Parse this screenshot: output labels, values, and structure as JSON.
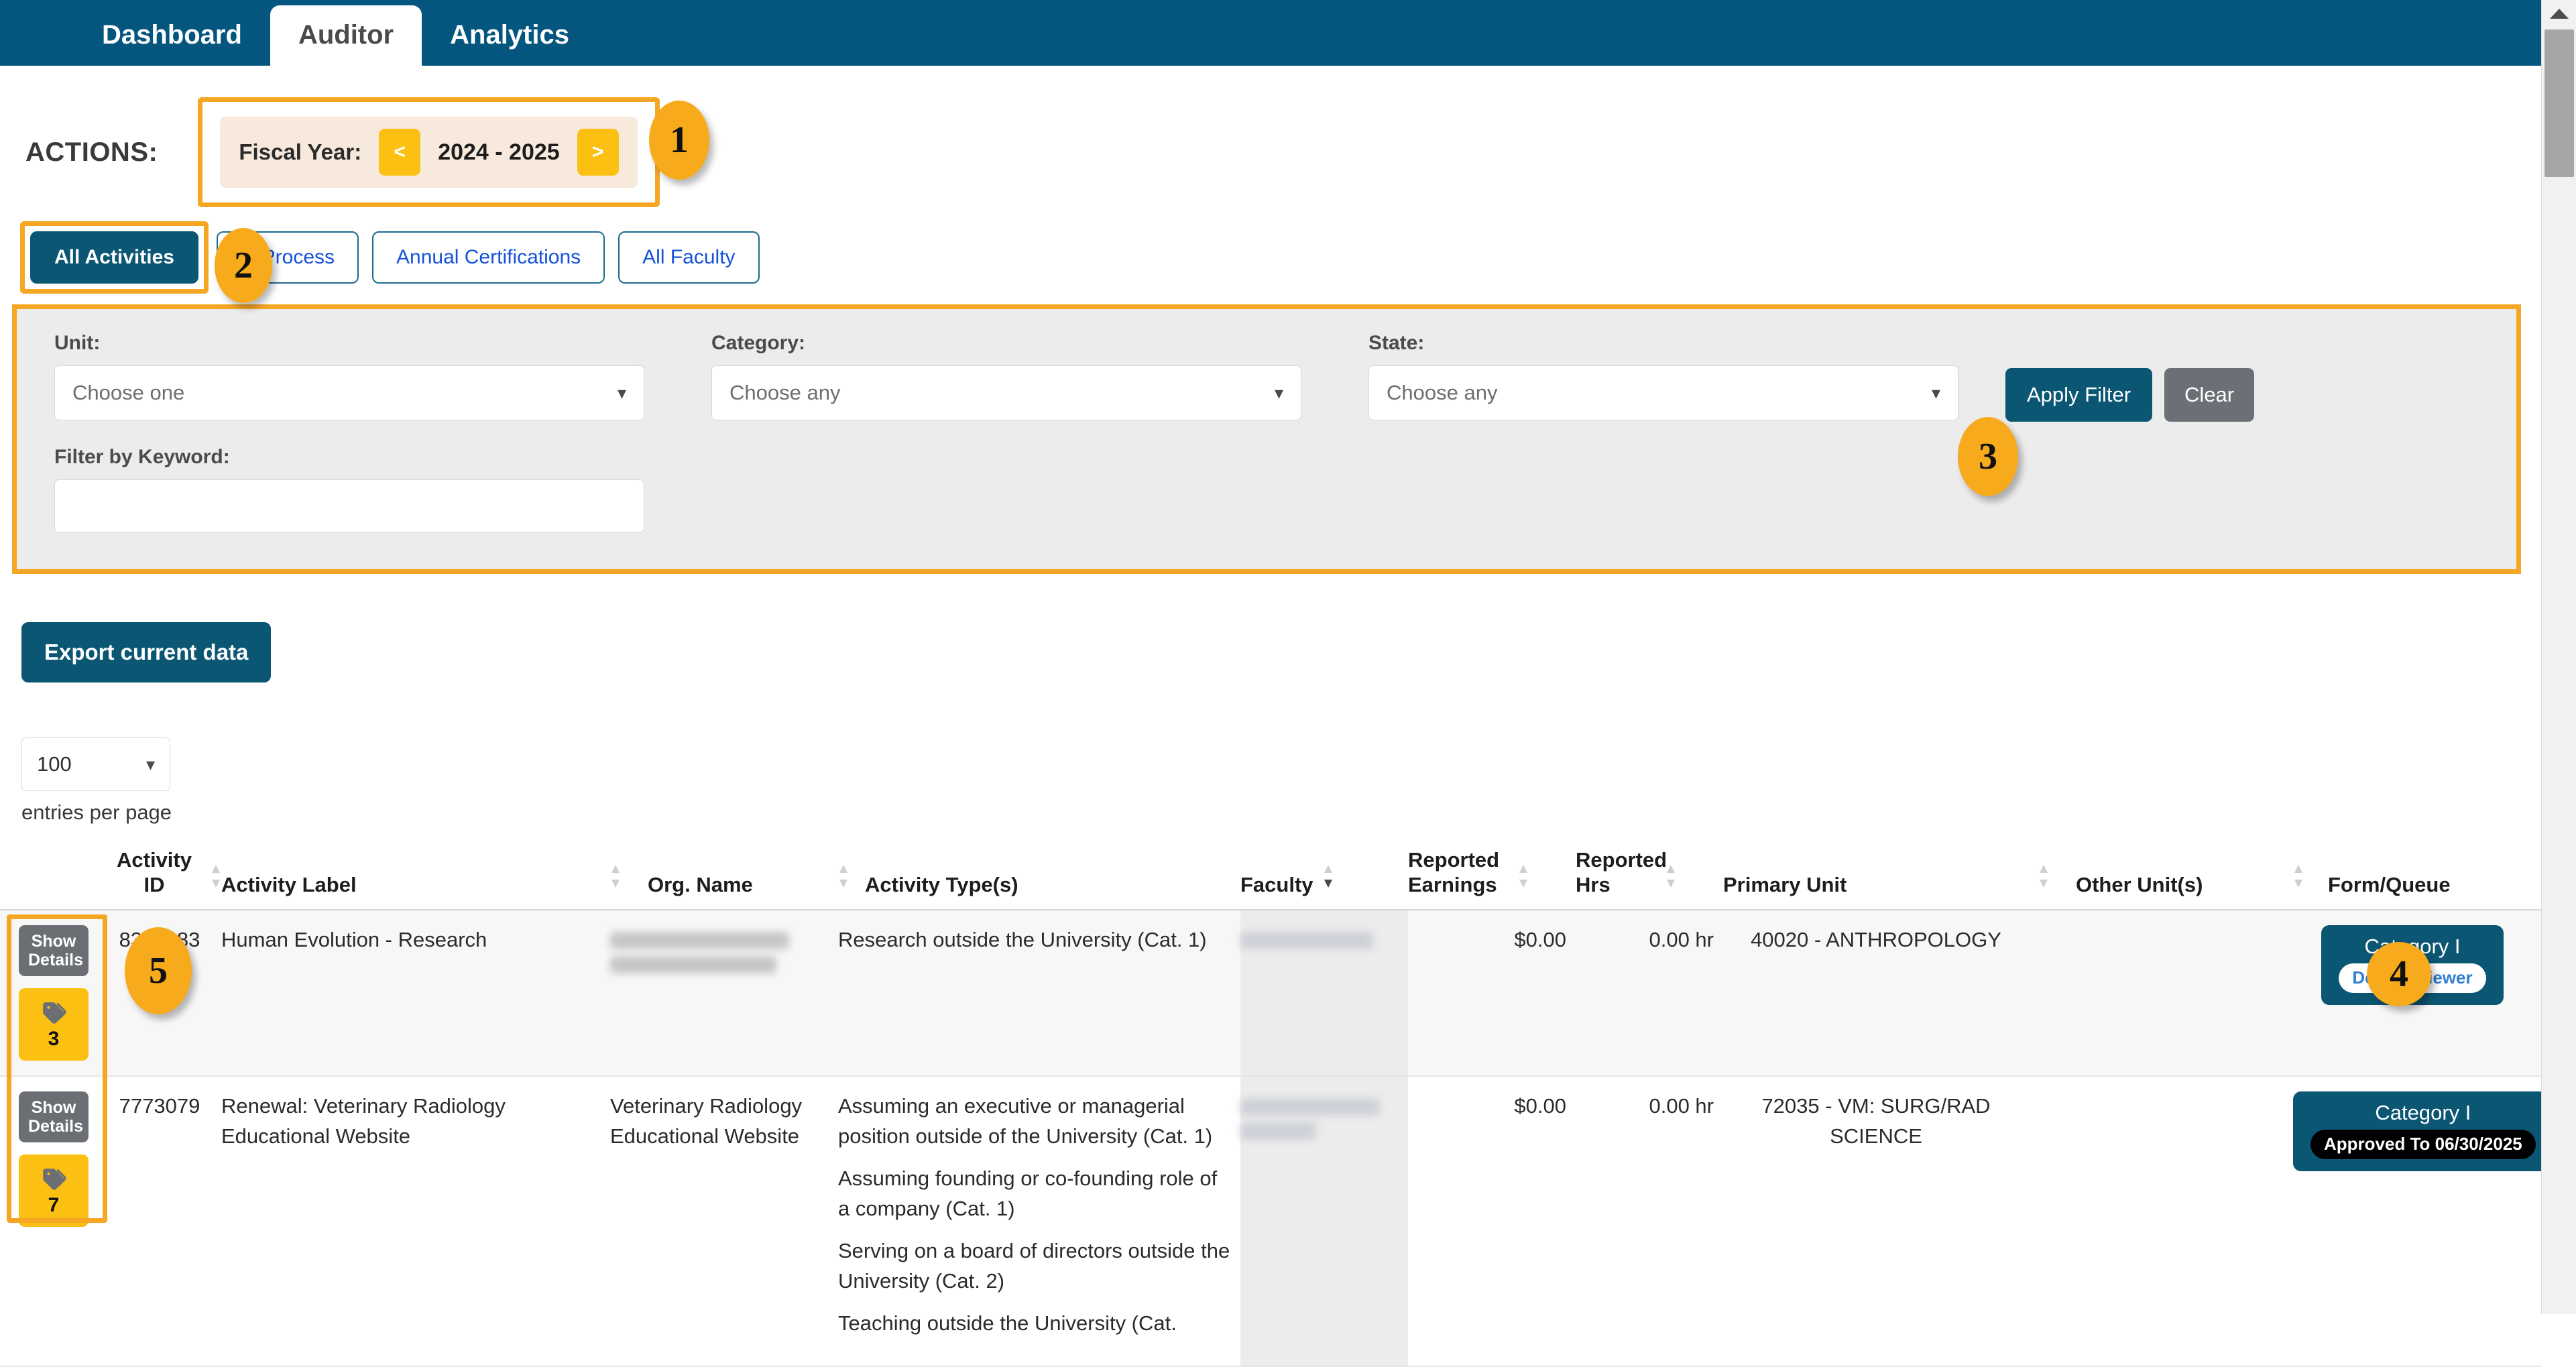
{
  "nav": {
    "tabs": [
      {
        "label": "Dashboard",
        "active": false
      },
      {
        "label": "Auditor",
        "active": true
      },
      {
        "label": "Analytics",
        "active": false
      }
    ]
  },
  "actions": {
    "label": "ACTIONS:",
    "fiscal_year": {
      "label": "Fiscal Year:",
      "prev": "<",
      "next": ">",
      "value": "2024 - 2025"
    }
  },
  "callouts": [
    {
      "number": "1"
    },
    {
      "number": "2"
    },
    {
      "number": "3"
    },
    {
      "number": "4"
    },
    {
      "number": "5"
    }
  ],
  "subtabs": [
    {
      "label": "All Activities",
      "active": true
    },
    {
      "label": "in Process",
      "active": false
    },
    {
      "label": "Annual Certifications",
      "active": false
    },
    {
      "label": "All Faculty",
      "active": false
    }
  ],
  "filters": {
    "unit": {
      "label": "Unit:",
      "value": "Choose one"
    },
    "category": {
      "label": "Category:",
      "value": "Choose any"
    },
    "state": {
      "label": "State:",
      "value": "Choose any"
    },
    "keyword": {
      "label": "Filter by Keyword:",
      "value": "",
      "placeholder": ""
    },
    "apply_label": "Apply Filter",
    "clear_label": "Clear"
  },
  "toolbar": {
    "export_label": "Export current data",
    "per_page_value": "100",
    "per_page_caption": "entries per page"
  },
  "table": {
    "columns": [
      {
        "key": "actions",
        "label": "",
        "sortable": false
      },
      {
        "key": "activity_id",
        "label": "Activity ID",
        "sortable": true,
        "sort": "none"
      },
      {
        "key": "activity_label",
        "label": "Activity Label",
        "sortable": false
      },
      {
        "key": "org_name",
        "label": "Org. Name",
        "sortable": true,
        "sort": "none"
      },
      {
        "key": "activity_types",
        "label": "Activity Type(s)",
        "sortable": true,
        "sort": "none"
      },
      {
        "key": "faculty",
        "label": "Faculty",
        "sortable": true,
        "sort": "desc"
      },
      {
        "key": "reported_earnings",
        "label": "Reported Earnings",
        "sortable": true,
        "sort": "none"
      },
      {
        "key": "reported_hrs",
        "label": "Reported Hrs",
        "sortable": true,
        "sort": "none"
      },
      {
        "key": "primary_unit",
        "label": "Primary Unit",
        "sortable": true,
        "sort": "none"
      },
      {
        "key": "other_units",
        "label": "Other Unit(s)",
        "sortable": true,
        "sort": "none"
      },
      {
        "key": "form_queue",
        "label": "Form/Queue",
        "sortable": false
      }
    ],
    "show_details_label": "Show Details",
    "rows": [
      {
        "tag_count": "3",
        "activity_id": "8349183",
        "activity_label": "Human Evolution - Research",
        "org_name": "",
        "org_name_redacted": true,
        "activity_types": [
          "Research outside the University (Cat. 1)"
        ],
        "faculty": "",
        "faculty_redacted": true,
        "reported_earnings": "$0.00",
        "reported_hrs": "0.00 hr",
        "primary_unit": "40020 - ANTHROPOLOGY",
        "other_units": "",
        "form_queue": {
          "title": "Category I",
          "badge": "Dept Reviewer",
          "badge_style": "white"
        }
      },
      {
        "tag_count": "7",
        "activity_id": "7773079",
        "activity_label": "Renewal: Veterinary Radiology Educational Website",
        "org_name": "Veterinary Radiology Educational Website",
        "org_name_redacted": false,
        "activity_types": [
          "Assuming an executive or managerial position outside of the University (Cat. 1)",
          "Assuming founding or co-founding role of a company (Cat. 1)",
          "Serving on a board of directors outside the University (Cat. 2)",
          "Teaching outside the University (Cat."
        ],
        "faculty": "",
        "faculty_redacted": true,
        "reported_earnings": "$0.00",
        "reported_hrs": "0.00 hr",
        "primary_unit": "72035 - VM: SURG/RAD SCIENCE",
        "other_units": "",
        "form_queue": {
          "title": "Category I",
          "badge": "Approved To 06/30/2025",
          "badge_style": "black"
        }
      }
    ]
  },
  "colors": {
    "brand_blue": "#04567f",
    "accent_teal": "#0b5673",
    "highlight_orange": "#f5a623",
    "badge_yellow": "#fcc013",
    "link_blue": "#1452d8"
  }
}
